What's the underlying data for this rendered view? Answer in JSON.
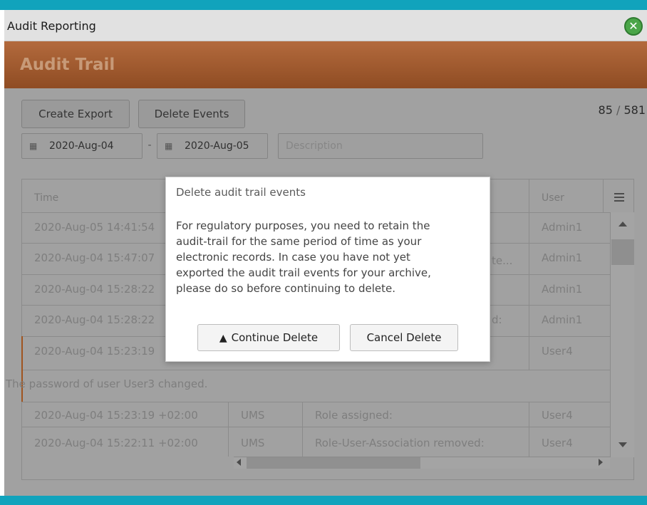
{
  "window": {
    "title": "Audit Reporting",
    "close_icon": "close-icon",
    "close_color": "#4aa548"
  },
  "header": {
    "title": "Audit Trail",
    "color": "#9b5a2f"
  },
  "toolbar": {
    "create_export_label": "Create Export",
    "delete_events_label": "Delete Events"
  },
  "counter": {
    "shown": "85",
    "separator": "/",
    "total": "581"
  },
  "filters": {
    "from_date": "2020-Aug-04",
    "dash": "-",
    "to_date": "2020-Aug-05",
    "description_placeholder": "Description",
    "calendar_icon": "calendar-icon"
  },
  "grid": {
    "columns": {
      "time": "Time",
      "user": "User"
    },
    "rows": [
      {
        "time": "2020-Aug-05 14:41:54",
        "partial": "",
        "user": "Admin1"
      },
      {
        "time": "2020-Aug-04 15:47:07",
        "partial": "te...",
        "user": "Admin1"
      },
      {
        "time": "2020-Aug-04 15:28:22",
        "partial": "",
        "user": "Admin1"
      },
      {
        "time": "2020-Aug-04 15:28:22",
        "partial": "d:",
        "user": "Admin1"
      },
      {
        "time": "2020-Aug-04 15:23:19",
        "partial": "",
        "user": "User4"
      }
    ],
    "detail_text": "The password of user User3 changed.",
    "bottom_rows": [
      {
        "time": "2020-Aug-04 15:23:19 +02:00",
        "system": "UMS",
        "description": "Role assigned:",
        "user": "User4"
      },
      {
        "time": "2020-Aug-04 15:22:11 +02:00",
        "system": "UMS",
        "description": "Role-User-Association removed:",
        "user": "User4"
      }
    ]
  },
  "dialog": {
    "title": "Delete audit trail events",
    "body_lines": [
      "For regulatory purposes, you need to retain the",
      "audit-trail for the same period of time as your",
      "electronic records. In case you have not yet",
      "exported the audit trail events for your archive,",
      "please do so before continuing to delete."
    ],
    "continue_label": "Continue Delete",
    "continue_icon": "warning-icon",
    "cancel_label": "Cancel Delete"
  },
  "colors": {
    "accent_bar": "#11a3bc",
    "selection_marker": "#a0541f"
  }
}
